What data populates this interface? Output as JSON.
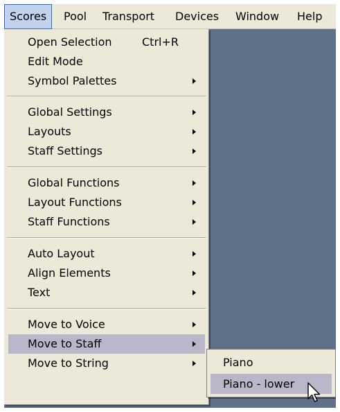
{
  "menubar": {
    "items": [
      {
        "label": "Scores"
      },
      {
        "label": "Pool"
      },
      {
        "label": "Transport"
      },
      {
        "label": "Devices"
      },
      {
        "label": "Window"
      },
      {
        "label": "Help"
      }
    ],
    "active": "Scores"
  },
  "scores_menu": {
    "items": [
      {
        "label": "Open Selection",
        "shortcut": "Ctrl+R"
      },
      {
        "label": "Edit Mode"
      },
      {
        "label": "Symbol Palettes",
        "submenu": true
      },
      {
        "label": "Global Settings",
        "submenu": true
      },
      {
        "label": "Layouts",
        "submenu": true
      },
      {
        "label": "Staff Settings",
        "submenu": true
      },
      {
        "label": "Global Functions",
        "submenu": true
      },
      {
        "label": "Layout Functions",
        "submenu": true
      },
      {
        "label": "Staff Functions",
        "submenu": true
      },
      {
        "label": "Auto Layout",
        "submenu": true
      },
      {
        "label": "Align Elements",
        "submenu": true
      },
      {
        "label": "Text",
        "submenu": true
      },
      {
        "label": "Move to Voice",
        "submenu": true
      },
      {
        "label": "Move to Staff",
        "submenu": true,
        "selected": true
      },
      {
        "label": "Move to String",
        "submenu": true
      }
    ]
  },
  "staff_submenu": {
    "items": [
      {
        "label": "Piano"
      },
      {
        "label": "Piano - lower",
        "selected": true
      }
    ]
  },
  "icons": {
    "submenu_arrow": "triangle-right-icon",
    "pointer": "mouse-pointer-icon"
  },
  "colors": {
    "menu_background": "#ece9d8",
    "workspace_background": "#5f7088",
    "selected_item": "#b9b6c9",
    "active_menubar_item": "#c1d2ee"
  }
}
